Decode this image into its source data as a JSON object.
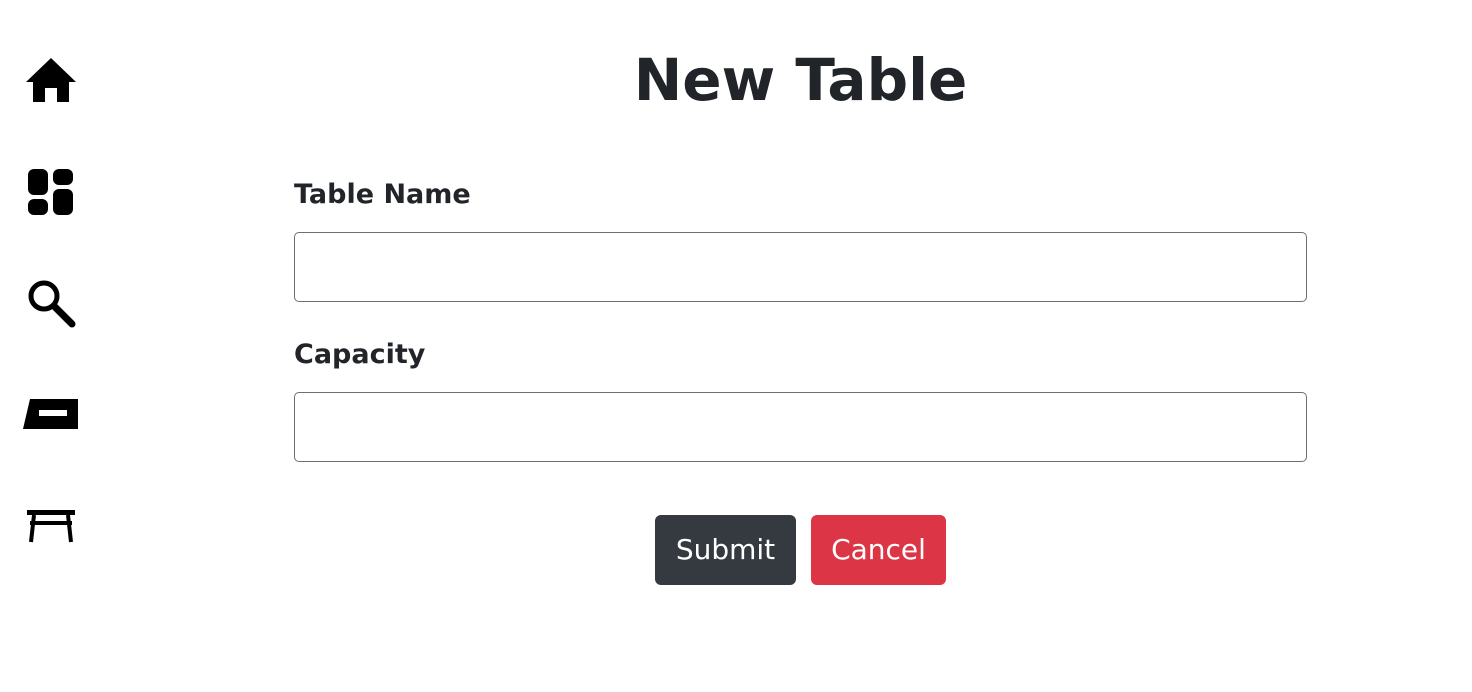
{
  "sidebar": {
    "items": [
      {
        "icon": "home-icon"
      },
      {
        "icon": "dashboard-icon"
      },
      {
        "icon": "search-icon"
      },
      {
        "icon": "reservations-icon"
      },
      {
        "icon": "table-icon"
      }
    ]
  },
  "page": {
    "title": "New Table"
  },
  "form": {
    "table_name": {
      "label": "Table Name",
      "value": "",
      "placeholder": ""
    },
    "capacity": {
      "label": "Capacity",
      "value": "",
      "placeholder": ""
    },
    "submit_label": "Submit",
    "cancel_label": "Cancel"
  },
  "colors": {
    "submit_bg": "#343a40",
    "cancel_bg": "#dc3545",
    "text": "#212529"
  }
}
